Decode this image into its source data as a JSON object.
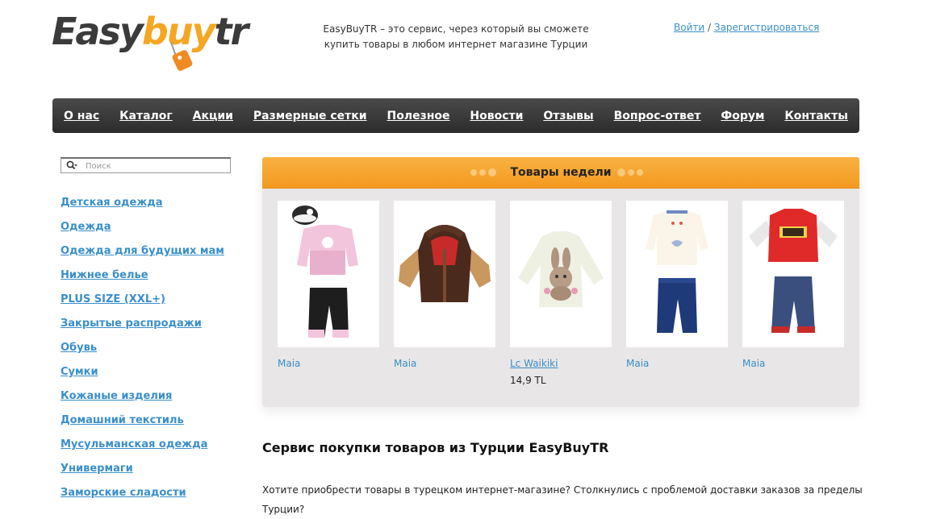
{
  "logo": {
    "part1": "Easy",
    "part2": "buy",
    "part3": "tr"
  },
  "tagline": {
    "line1": "EasyBuyTR – это сервис, через который вы сможете",
    "line2": "купить товары в любом интернет магазине Турции"
  },
  "auth": {
    "login": "Войти",
    "separator": "/",
    "register": "Зарегистрироваться"
  },
  "nav": [
    "О нас",
    "Каталог",
    "Акции",
    "Размерные сетки",
    "Полезное",
    "Новости",
    "Отзывы",
    "Вопрос-ответ",
    "Форум",
    "Контакты"
  ],
  "search": {
    "placeholder": "Поиск",
    "icon": "search-icon"
  },
  "categories": [
    "Детская одежда",
    "Одежда",
    "Одежда для будущих мам",
    "Нижнее белье",
    "PLUS SIZE (XXL+)",
    "Закрытые распродажи",
    "Обувь",
    "Сумки",
    "Кожаные изделия",
    "Домашний текстиль",
    "Мусульманская одежда",
    "Универмаги",
    "Заморские сладости"
  ],
  "week": {
    "title": "Товары недели",
    "products": [
      {
        "brand": "Maia",
        "price": "",
        "image": "pink-outfit-with-hat"
      },
      {
        "brand": "Maia",
        "price": "",
        "image": "brown-hooded-vest"
      },
      {
        "brand": "Lc Waikiki",
        "price": "14,9 TL",
        "image": "bunny-sweatshirt"
      },
      {
        "brand": "Maia",
        "price": "",
        "image": "white-top-with-jeans"
      },
      {
        "brand": "Maia",
        "price": "",
        "image": "red-top-with-jeans"
      }
    ]
  },
  "article": {
    "title": "Сервис покупки товаров из Турции EasyBuyTR",
    "text": "Хотите приобрести товары в турецком интернет-магазине? Столкнулись с проблемой доставки заказов за пределы Турции?"
  },
  "colors": {
    "accent": "#f39a1f",
    "link": "#3a8fc9",
    "nav": "#3a3a3a"
  }
}
